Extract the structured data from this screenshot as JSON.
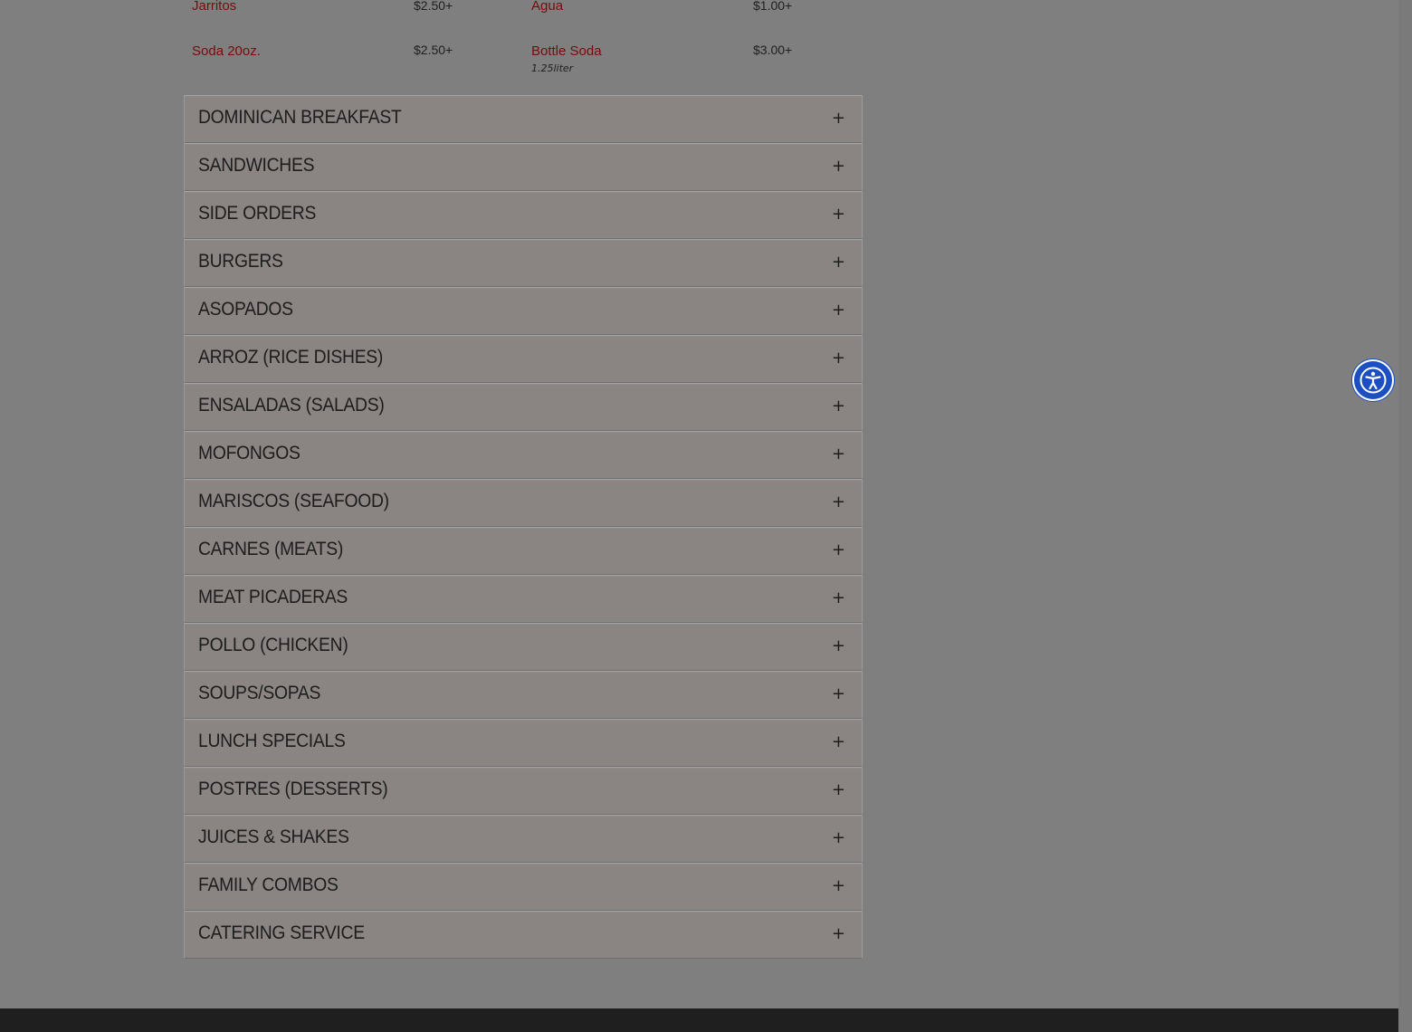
{
  "drinks": [
    {
      "name": "Jarritos",
      "price": "$2.50+",
      "desc": ""
    },
    {
      "name": "Agua",
      "price": "$1.00+",
      "desc": ""
    },
    {
      "name": "Soda 20oz.",
      "price": "$2.50+",
      "desc": ""
    },
    {
      "name": "Bottle Soda",
      "price": "$3.00+",
      "desc": "1.25liter"
    }
  ],
  "sections": [
    {
      "title": "Dominican Breakfast",
      "toggle": "+"
    },
    {
      "title": "Sandwiches",
      "toggle": "+"
    },
    {
      "title": "Side Orders",
      "toggle": "+"
    },
    {
      "title": "Burgers",
      "toggle": "+"
    },
    {
      "title": "Asopados",
      "toggle": "+"
    },
    {
      "title": "Arroz (Rice Dishes)",
      "toggle": "+"
    },
    {
      "title": "Ensaladas (Salads)",
      "toggle": "+"
    },
    {
      "title": "Mofongos",
      "toggle": "+"
    },
    {
      "title": "Mariscos (Seafood)",
      "toggle": "+"
    },
    {
      "title": "Carnes (Meats)",
      "toggle": "+"
    },
    {
      "title": "Meat Picaderas",
      "toggle": "+"
    },
    {
      "title": "Pollo (Chicken)",
      "toggle": "+"
    },
    {
      "title": "Soups/Sopas",
      "toggle": "+"
    },
    {
      "title": "Lunch Specials",
      "toggle": "+"
    },
    {
      "title": "Postres (Desserts)",
      "toggle": "+"
    },
    {
      "title": "Juices & Shakes",
      "toggle": "+"
    },
    {
      "title": "Family Combos",
      "toggle": "+"
    },
    {
      "title": "Catering Service",
      "toggle": "+"
    }
  ],
  "accessibility": {
    "icon": "accessibility-icon"
  },
  "colors": {
    "overlay_bg": "#7f7f7f",
    "item_name": "#7b0a0a",
    "accessibility_button": "#1b4fc2"
  }
}
